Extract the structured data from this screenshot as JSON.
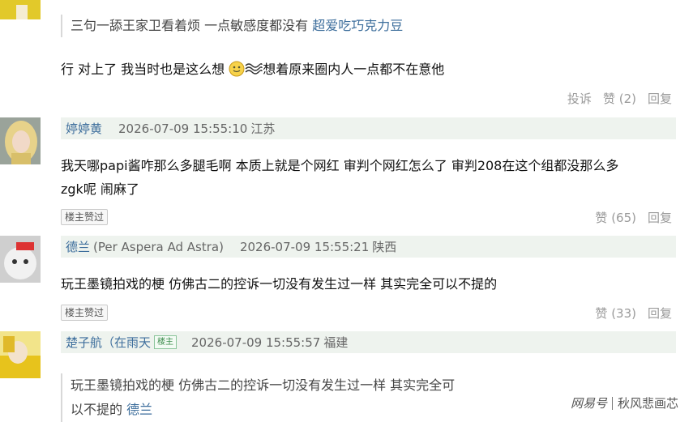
{
  "top_quote": {
    "text": "三句一舔王家卫看着烦 一点敏感度都没有",
    "author": "超爱吃巧克力豆"
  },
  "reply0": {
    "text_a": "行 对上了 我当时也是这么想",
    "text_b": "想着原来圈内人一点都不在意他",
    "actions": {
      "report": "投诉",
      "like": "赞",
      "like_count": "(2)",
      "reply": "回复"
    }
  },
  "comments": [
    {
      "username": "婷婷黄",
      "timestamp": "2026-07-09 15:55:10",
      "location": "江苏",
      "text_line1": "我天哪papi酱咋那么多腿毛啊 本质上就是个网红 审判个网红怎么了 审判208在这个组都没那么多",
      "text_line2": "zgk呢 闹麻了",
      "badge": "楼主赞过",
      "like": "赞",
      "like_count": "(65)",
      "reply": "回复"
    },
    {
      "username": "德兰",
      "username_sub": "(Per Aspera Ad Astra)",
      "timestamp": "2026-07-09 15:55:21",
      "location": "陕西",
      "text_line1": "玩王墨镜拍戏的梗 仿佛古二的控诉一切没有发生过一样 其实完全可以不提的",
      "badge": "楼主赞过",
      "like": "赞",
      "like_count": "(33)",
      "reply": "回复"
    },
    {
      "username": "楚子航（在雨天",
      "owner_tag": "楼主",
      "timestamp": "2026-07-09 15:55:57",
      "location": "福建",
      "quote_line1": "玩王墨镜拍戏的梗 仿佛古二的控诉一切没有发生过一样 其实完全可",
      "quote_line2": "以不提的",
      "quote_author": "德兰"
    }
  ],
  "watermark": {
    "brand": "网易号",
    "author": "秋风悲画芯"
  }
}
